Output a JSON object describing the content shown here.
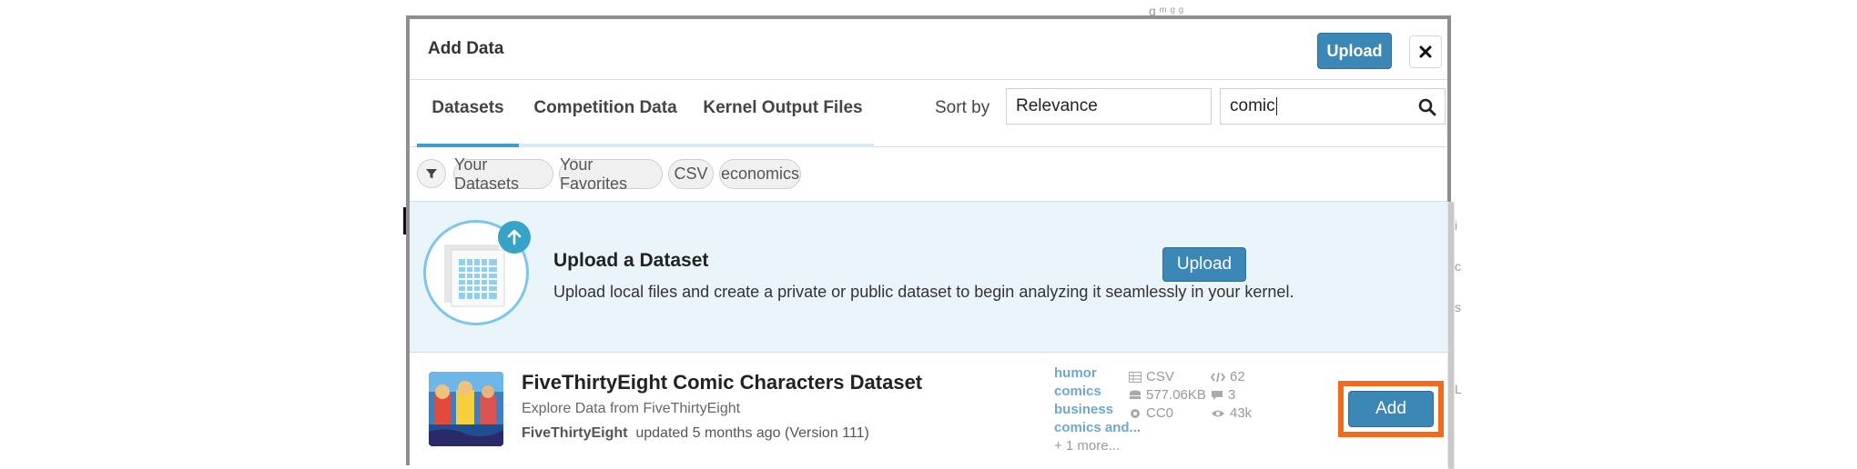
{
  "modal": {
    "title": "Add Data",
    "header_upload_label": "Upload",
    "close_icon": "close-icon"
  },
  "tabs": [
    {
      "label": "Datasets",
      "active": true
    },
    {
      "label": "Competition Data",
      "active": false
    },
    {
      "label": "Kernel Output Files",
      "active": false
    }
  ],
  "sort": {
    "label": "Sort by",
    "value": "Relevance"
  },
  "search": {
    "value": "comic",
    "icon": "search-icon"
  },
  "filters": {
    "icon": "filter-icon",
    "chips": [
      "Your Datasets",
      "Your Favorites",
      "CSV",
      "economics"
    ]
  },
  "upload_banner": {
    "title": "Upload a Dataset",
    "description": "Upload local files and create a private or public dataset to begin analyzing it seamlessly in your kernel.",
    "button_label": "Upload"
  },
  "dataset": {
    "title": "FiveThirtyEight Comic Characters Dataset",
    "subtitle": "Explore Data from FiveThirtyEight",
    "owner": "FiveThirtyEight",
    "updated": "updated 5 months ago (Version 111)",
    "tags": [
      "humor",
      "comics",
      "business",
      "comics and..."
    ],
    "more_tags": "+ 1 more...",
    "file_type": "CSV",
    "size": "577.06KB",
    "license": "CC0",
    "kernels": "62",
    "comments": "3",
    "views": "43k",
    "add_label": "Add"
  },
  "colors": {
    "primary_button": "#3b87b5",
    "highlight": "#f26b1d",
    "tab_active": "#3d9fd0",
    "banner_bg": "#e9f5fb",
    "tag_link": "#6fa8c8"
  }
}
